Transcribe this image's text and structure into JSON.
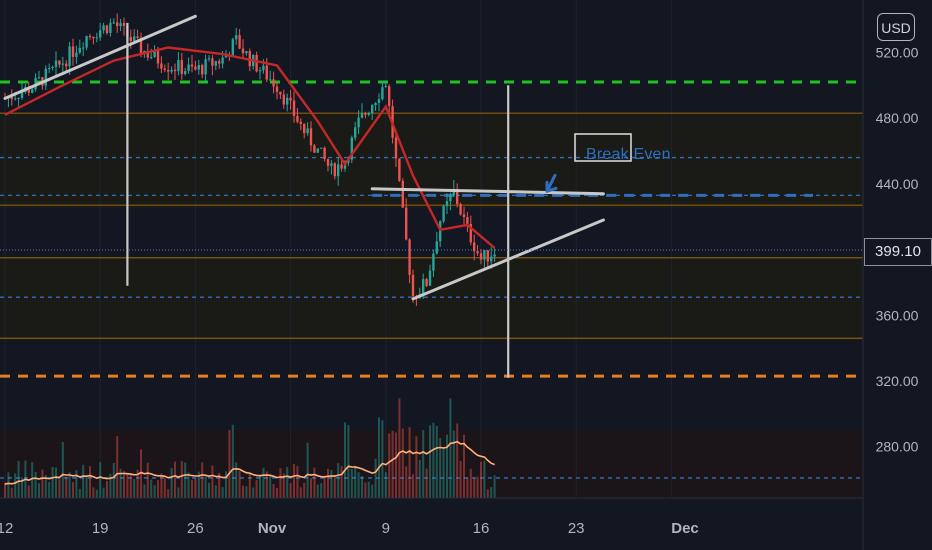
{
  "currency": "USD",
  "last_price_label": "399.10",
  "annotation": "Break Even",
  "colors": {
    "background": "#131722",
    "up": "#26a69a",
    "down": "#ef5350",
    "ma": "#c62828",
    "volume_ma": "#ffb07a",
    "green_dashed": "#21c21f",
    "orange_dashed": "#e67e22",
    "blue_dashed": "#2e6fbf",
    "band_line": "#8a5a14",
    "trend": "#c8c8c8"
  },
  "chart_data": {
    "type": "candlestick",
    "currency": "USD",
    "y_ticks": [
      520,
      480,
      440,
      399.1,
      360,
      320,
      280
    ],
    "ylim": [
      250,
      540
    ],
    "x_ticks": [
      "12",
      "19",
      "26",
      "Nov",
      "9",
      "16",
      "23",
      "Dec"
    ],
    "price_series": [
      {
        "date": "Oct 12",
        "close": 492
      },
      {
        "date": "Oct 14",
        "close": 499
      },
      {
        "date": "Oct 16",
        "close": 512
      },
      {
        "date": "Oct 18",
        "close": 530
      },
      {
        "date": "Oct 20",
        "close": 538
      },
      {
        "date": "Oct 22",
        "close": 522
      },
      {
        "date": "Oct 24",
        "close": 512
      },
      {
        "date": "Oct 26",
        "close": 509
      },
      {
        "date": "Oct 28",
        "close": 516
      },
      {
        "date": "Oct 29",
        "close": 527
      },
      {
        "date": "Oct 30",
        "close": 516
      },
      {
        "date": "Nov 1",
        "close": 500
      },
      {
        "date": "Nov 3",
        "close": 472
      },
      {
        "date": "Nov 5",
        "close": 448
      },
      {
        "date": "Nov 6",
        "close": 454
      },
      {
        "date": "Nov 7",
        "close": 477
      },
      {
        "date": "Nov 9",
        "close": 502
      },
      {
        "date": "Nov 10",
        "close": 437
      },
      {
        "date": "Nov 11",
        "close": 372
      },
      {
        "date": "Nov 12",
        "close": 380
      },
      {
        "date": "Nov 13",
        "close": 418
      },
      {
        "date": "Nov 14",
        "close": 435
      },
      {
        "date": "Nov 15",
        "close": 412
      },
      {
        "date": "Nov 16",
        "close": 394
      },
      {
        "date": "Nov 17",
        "close": 399.1
      }
    ],
    "ma_series": [
      {
        "date": "Oct 12",
        "value": 482
      },
      {
        "date": "Oct 16",
        "value": 499
      },
      {
        "date": "Oct 20",
        "value": 515
      },
      {
        "date": "Oct 24",
        "value": 523
      },
      {
        "date": "Oct 28",
        "value": 519
      },
      {
        "date": "Nov 1",
        "value": 512
      },
      {
        "date": "Nov 4",
        "value": 478
      },
      {
        "date": "Nov 6",
        "value": 452
      },
      {
        "date": "Nov 9",
        "value": 487
      },
      {
        "date": "Nov 11",
        "value": 445
      },
      {
        "date": "Nov 13",
        "value": 412
      },
      {
        "date": "Nov 15",
        "value": 415
      },
      {
        "date": "Nov 17",
        "value": 401
      }
    ],
    "horizontal_levels": [
      {
        "price": 502,
        "style": "dashed",
        "color": "green"
      },
      {
        "price": 483,
        "style": "solid",
        "color": "orange"
      },
      {
        "price": 456,
        "style": "dashed",
        "color": "blue"
      },
      {
        "price": 433,
        "style": "dashed",
        "color": "blue"
      },
      {
        "price": 427,
        "style": "solid",
        "color": "orange"
      },
      {
        "price": 395,
        "style": "solid",
        "color": "orange"
      },
      {
        "price": 371,
        "style": "dashed",
        "color": "blue"
      },
      {
        "price": 346,
        "style": "solid",
        "color": "orange"
      },
      {
        "price": 323,
        "style": "dashed",
        "color": "orange"
      },
      {
        "price": 261,
        "style": "dashed",
        "color": "blue"
      }
    ],
    "trendlines": [
      {
        "from": {
          "date": "Oct 12",
          "price": 492
        },
        "to": {
          "date": "Oct 26",
          "price": 542
        }
      },
      {
        "from": {
          "date": "Nov 8",
          "price": 437
        },
        "to": {
          "date": "Nov 25",
          "price": 434
        }
      },
      {
        "from": {
          "date": "Nov 11",
          "price": 370
        },
        "to": {
          "date": "Nov 25",
          "price": 418
        }
      }
    ],
    "verticals": [
      {
        "date": "Oct 21",
        "from": 538,
        "to": 378
      },
      {
        "date": "Nov 18",
        "from": 500,
        "to": 322
      }
    ],
    "annotation": {
      "text": "Break Even",
      "date": "Nov 21",
      "price": 433
    }
  }
}
